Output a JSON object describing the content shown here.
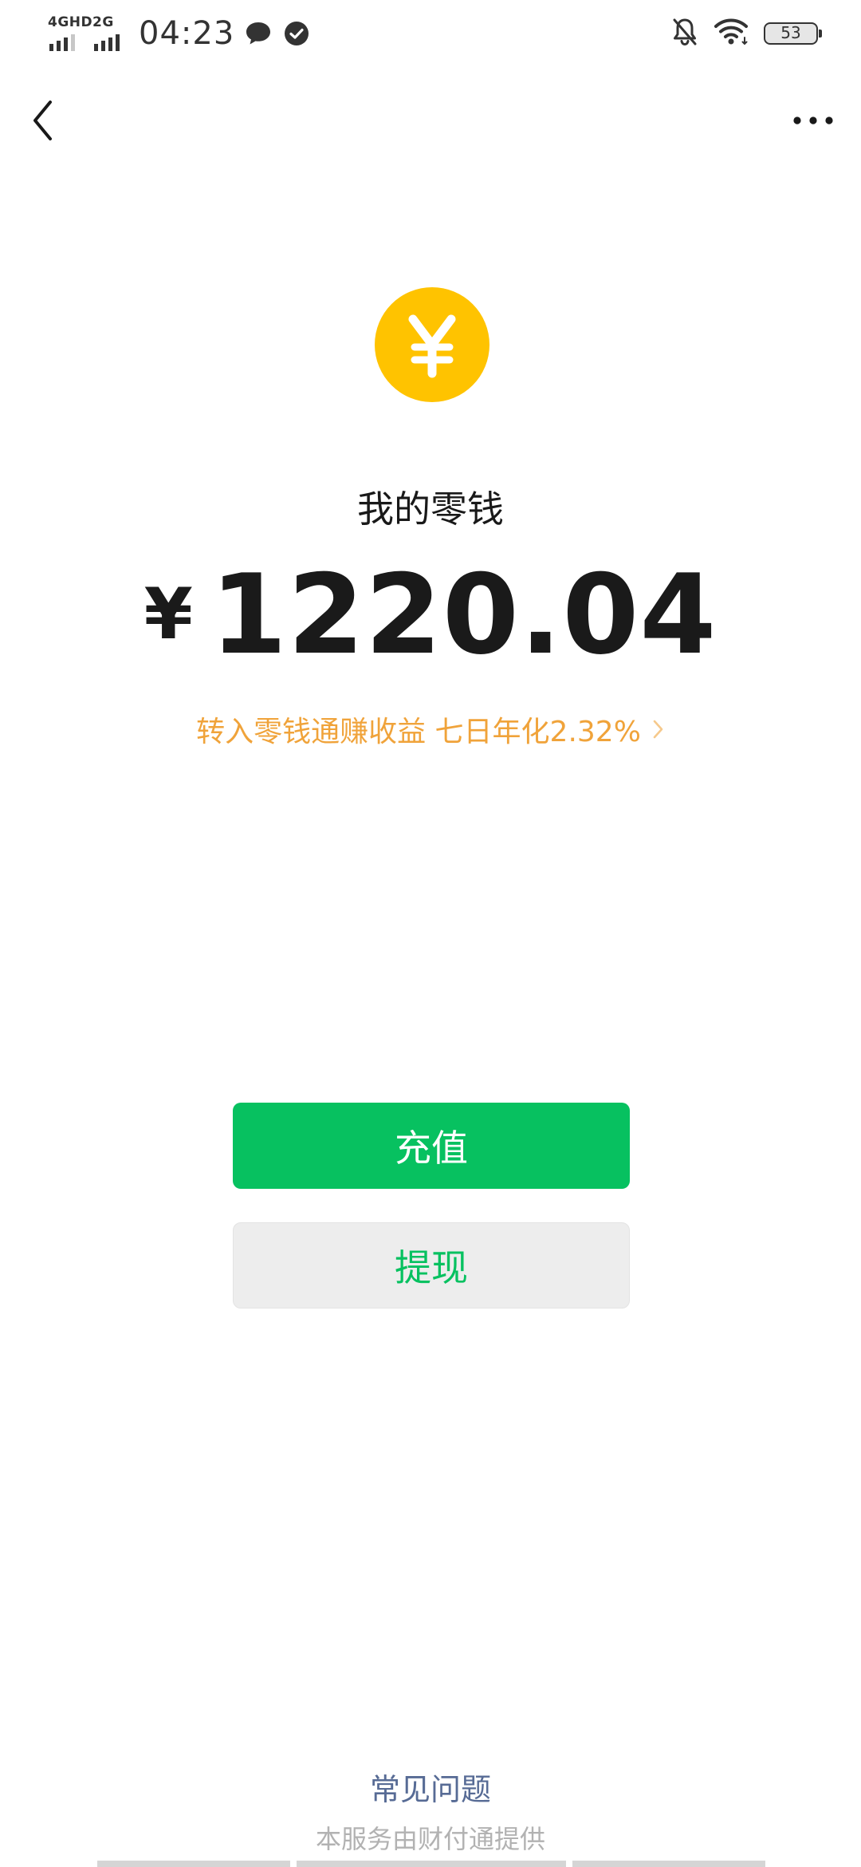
{
  "status_bar": {
    "network_1": "4GHD",
    "network_2": "2G",
    "time": "04:23",
    "battery": "53"
  },
  "nav": {
    "back_icon": "chevron-left-icon",
    "more_icon": "more-dots-icon"
  },
  "wallet": {
    "coin_icon": "yuan-coin-icon",
    "title": "我的零钱",
    "currency_symbol": "¥",
    "balance": "1220.04",
    "promo_text": "转入零钱通赚收益 七日年化2.32%"
  },
  "actions": {
    "recharge_label": "充值",
    "withdraw_label": "提现"
  },
  "footer": {
    "faq_label": "常见问题",
    "provider_note": "本服务由财付通提供"
  },
  "colors": {
    "accent_green": "#07c160",
    "coin_yellow": "#ffc300",
    "promo_orange": "#f0a33a",
    "link_blue": "#576b95"
  }
}
